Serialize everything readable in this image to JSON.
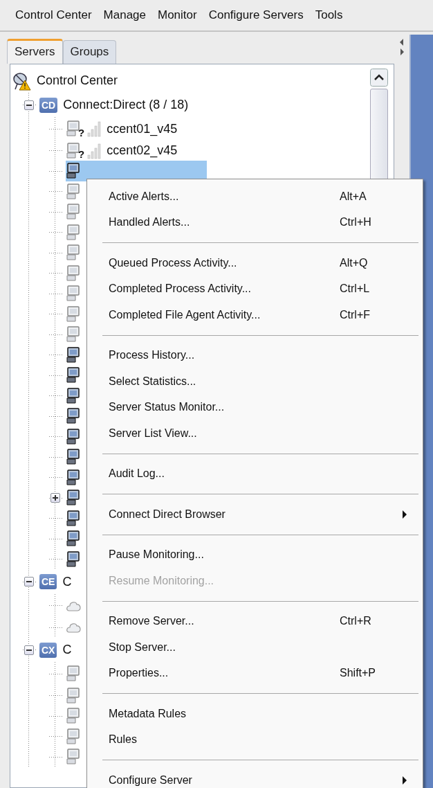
{
  "menu_bar": [
    "Control Center",
    "Manage",
    "Monitor",
    "Configure Servers",
    "Tools"
  ],
  "tabs": [
    {
      "label": "Servers",
      "selected": true
    },
    {
      "label": "Groups",
      "selected": false
    }
  ],
  "tree": {
    "label": "Control Center",
    "kind": "root",
    "warning": true,
    "children": [
      {
        "kind": "group",
        "badge": "CD",
        "label": "Connect:Direct (8 / 18)",
        "expanded": true,
        "children": [
          {
            "kind": "server",
            "label": "ccent01_v45",
            "connected": false,
            "mark": "?",
            "selected": false
          },
          {
            "kind": "server",
            "label": "ccent02_v45",
            "connected": false,
            "mark": "?",
            "selected": false
          },
          {
            "kind": "server",
            "connected": true,
            "selected": true
          },
          {
            "kind": "server",
            "connected": false,
            "selected": false
          },
          {
            "kind": "server",
            "connected": false,
            "selected": false
          },
          {
            "kind": "server",
            "connected": false,
            "selected": false
          },
          {
            "kind": "server",
            "connected": false,
            "selected": false
          },
          {
            "kind": "server",
            "connected": false,
            "selected": false
          },
          {
            "kind": "server",
            "connected": false,
            "selected": false
          },
          {
            "kind": "server",
            "connected": false,
            "selected": false
          },
          {
            "kind": "server",
            "connected": false,
            "selected": false
          },
          {
            "kind": "server",
            "connected": true,
            "selected": false
          },
          {
            "kind": "server",
            "connected": true,
            "selected": false
          },
          {
            "kind": "server",
            "connected": true,
            "selected": false
          },
          {
            "kind": "server",
            "connected": true,
            "selected": false
          },
          {
            "kind": "server",
            "connected": true,
            "selected": false
          },
          {
            "kind": "server",
            "connected": true,
            "selected": false
          },
          {
            "kind": "server",
            "connected": true,
            "selected": false
          },
          {
            "kind": "server",
            "connected": true,
            "selected": false,
            "expanded": false
          },
          {
            "kind": "server",
            "connected": true,
            "selected": false
          },
          {
            "kind": "server",
            "connected": true,
            "selected": false
          },
          {
            "kind": "server",
            "connected": true,
            "selected": false
          }
        ]
      },
      {
        "kind": "group",
        "badge": "CE",
        "label": "C",
        "expanded": true,
        "children": [
          {
            "kind": "agent",
            "selected": false
          },
          {
            "kind": "agent",
            "selected": false
          }
        ]
      },
      {
        "kind": "group",
        "badge": "CX",
        "label": "C",
        "expanded": true,
        "children": [
          {
            "kind": "server",
            "connected": false,
            "selected": false
          },
          {
            "kind": "server",
            "connected": false,
            "selected": false
          },
          {
            "kind": "server",
            "connected": false,
            "selected": false
          },
          {
            "kind": "server",
            "connected": false,
            "selected": false
          },
          {
            "kind": "server",
            "connected": false,
            "selected": false
          }
        ]
      }
    ]
  },
  "context_menu": [
    {
      "kind": "item",
      "label": "Active Alerts...",
      "shortcut": "Alt+A",
      "disabled": false
    },
    {
      "kind": "item",
      "label": "Handled Alerts...",
      "shortcut": "Ctrl+H",
      "disabled": false
    },
    {
      "kind": "separator"
    },
    {
      "kind": "item",
      "label": "Queued Process Activity...",
      "shortcut": "Alt+Q",
      "disabled": false
    },
    {
      "kind": "item",
      "label": "Completed Process Activity...",
      "shortcut": "Ctrl+L",
      "disabled": false
    },
    {
      "kind": "item",
      "label": "Completed File Agent Activity...",
      "shortcut": "Ctrl+F",
      "disabled": false
    },
    {
      "kind": "separator"
    },
    {
      "kind": "item",
      "label": "Process History...",
      "disabled": false
    },
    {
      "kind": "item",
      "label": "Select Statistics...",
      "disabled": false
    },
    {
      "kind": "item",
      "label": "Server Status Monitor...",
      "disabled": false
    },
    {
      "kind": "item",
      "label": "Server List View...",
      "disabled": false
    },
    {
      "kind": "separator"
    },
    {
      "kind": "item",
      "label": "Audit Log...",
      "disabled": false
    },
    {
      "kind": "separator"
    },
    {
      "kind": "submenu",
      "label": "Connect Direct Browser",
      "disabled": false
    },
    {
      "kind": "separator"
    },
    {
      "kind": "item",
      "label": "Pause Monitoring...",
      "disabled": false
    },
    {
      "kind": "item",
      "label": "Resume Monitoring...",
      "disabled": true
    },
    {
      "kind": "separator"
    },
    {
      "kind": "item",
      "label": "Remove Server...",
      "shortcut": "Ctrl+R",
      "disabled": false
    },
    {
      "kind": "item",
      "label": "Stop Server...",
      "disabled": false
    },
    {
      "kind": "item",
      "label": "Properties...",
      "shortcut": "Shift+P",
      "disabled": false
    },
    {
      "kind": "separator"
    },
    {
      "kind": "item",
      "label": "Metadata Rules",
      "disabled": false
    },
    {
      "kind": "item",
      "label": "Rules",
      "disabled": false
    },
    {
      "kind": "separator"
    },
    {
      "kind": "submenu",
      "label": "Configure Server",
      "disabled": false
    }
  ]
}
